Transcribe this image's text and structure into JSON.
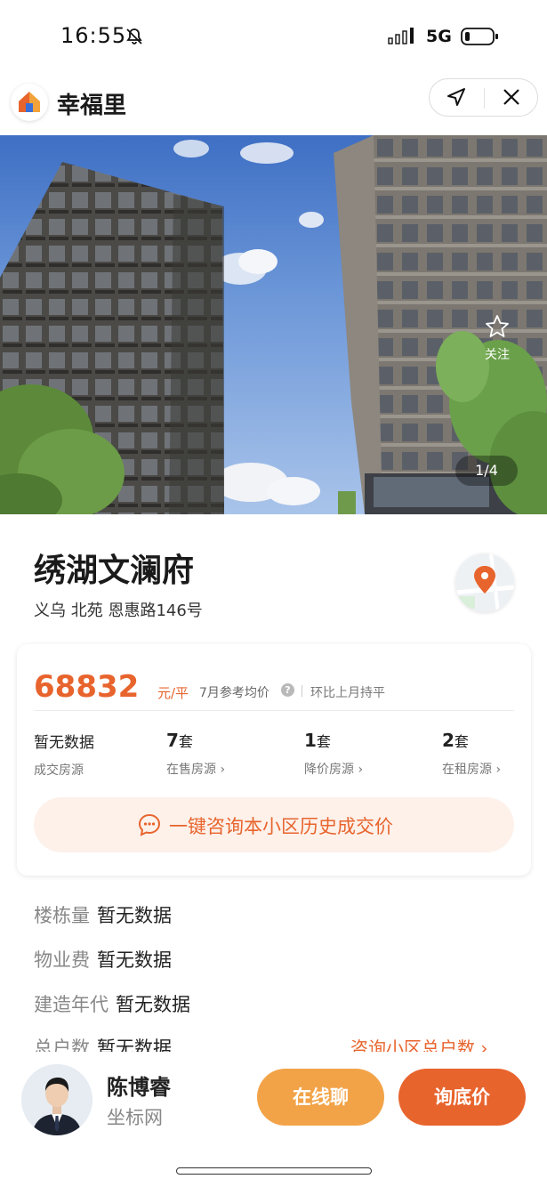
{
  "status_bar": {
    "time": "16:55",
    "network": "5G"
  },
  "app": {
    "title": "幸福里"
  },
  "hero": {
    "follow_label": "关注",
    "pager": "1/4"
  },
  "community": {
    "name": "绣湖文澜府",
    "address": "义乌 北苑 恩惠路146号"
  },
  "price": {
    "value": "68832",
    "unit": "元/平",
    "reference": "7月参考均价",
    "help": "?",
    "trend": "环比上月持平"
  },
  "stats": [
    {
      "value": "暂无数据",
      "unit": "",
      "label": "成交房源"
    },
    {
      "value": "7",
      "unit": "套",
      "label": "在售房源 ›"
    },
    {
      "value": "1",
      "unit": "套",
      "label": "降价房源 ›"
    },
    {
      "value": "2",
      "unit": "套",
      "label": "在租房源 ›"
    }
  ],
  "consult": {
    "label": "一键咨询本小区历史成交价"
  },
  "info": [
    {
      "label": "楼栋量",
      "value": "暂无数据"
    },
    {
      "label": "物业费",
      "value": "暂无数据"
    },
    {
      "label": "建造年代",
      "value": "暂无数据"
    },
    {
      "label": "总户数",
      "value": "暂无数据"
    }
  ],
  "info_link": "咨询小区总户数 ›",
  "agent": {
    "name": "陈博睿",
    "company": "坐标网"
  },
  "actions": {
    "chat": "在线聊",
    "ask_price": "询底价"
  },
  "colors": {
    "accent": "#e8642d",
    "chat": "#f2a348",
    "consult_bg": "#fdf1ea"
  }
}
